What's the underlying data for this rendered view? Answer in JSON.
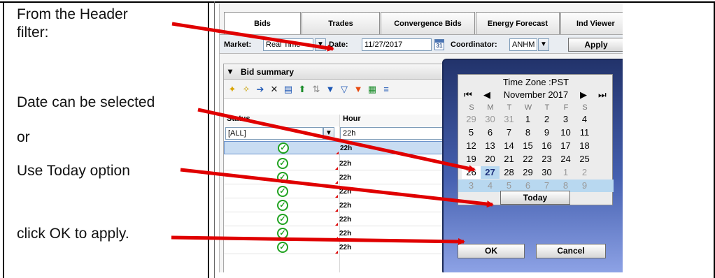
{
  "instructions": {
    "line1": "From the Header",
    "line2": "filter:",
    "line3": "Date can be selected",
    "line4": "or",
    "line5": "Use Today option",
    "line6": "click OK to apply."
  },
  "tabs": [
    {
      "label": "Bids",
      "active": true
    },
    {
      "label": "Trades",
      "active": false
    },
    {
      "label": "Convergence Bids",
      "active": false
    },
    {
      "label": "Energy Forecast",
      "active": false
    },
    {
      "label": "Ind Viewer",
      "active": false
    }
  ],
  "filter_bar": {
    "market_label": "Market:",
    "market_value": "Real Time",
    "date_label": "Date:",
    "date_value": "11/27/2017",
    "calendar_icon_text": "31",
    "coordinator_label": "Coordinator:",
    "coordinator_value": "ANHM",
    "apply_label": "Apply"
  },
  "bid_summary": {
    "title": "Bid summary",
    "columns": {
      "status": "Status",
      "hour": "Hour"
    },
    "status_filter": "[ALL]",
    "hour_filter": "22h",
    "rows": [
      {
        "hour": "22h"
      },
      {
        "hour": "22h"
      },
      {
        "hour": "22h"
      },
      {
        "hour": "22h"
      },
      {
        "hour": "22h"
      },
      {
        "hour": "22h"
      },
      {
        "hour": "22h"
      },
      {
        "hour": "22h"
      }
    ]
  },
  "calendar": {
    "timezone": "Time Zone :PST",
    "month": "November 2017",
    "weekdays": [
      "S",
      "M",
      "T",
      "W",
      "T",
      "F",
      "S"
    ],
    "weeks": [
      [
        "29",
        "30",
        "31",
        "1",
        "2",
        "3",
        "4"
      ],
      [
        "5",
        "6",
        "7",
        "8",
        "9",
        "10",
        "11"
      ],
      [
        "12",
        "13",
        "14",
        "15",
        "16",
        "17",
        "18"
      ],
      [
        "19",
        "20",
        "21",
        "22",
        "23",
        "24",
        "25"
      ],
      [
        "26",
        "27",
        "28",
        "29",
        "30",
        "1",
        "2"
      ],
      [
        "3",
        "4",
        "5",
        "6",
        "7",
        "8",
        "9"
      ]
    ],
    "selected_day": "27",
    "today_label": "Today",
    "ok_label": "OK",
    "cancel_label": "Cancel"
  },
  "icons": {
    "chevron": "chevron-down-icon",
    "check": "check-circle-icon",
    "calendar": "calendar-icon"
  },
  "colors": {
    "arrow": "#e00000",
    "check": "#1fa21f",
    "popup_top": "#22336b",
    "popup_bottom": "#8ea3e6",
    "selected_week": "#b8d8f0"
  }
}
